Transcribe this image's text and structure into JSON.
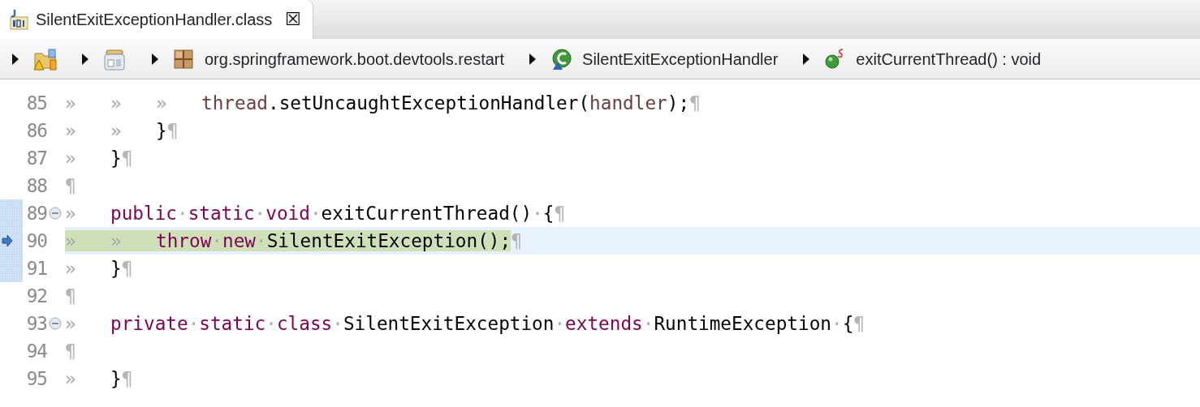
{
  "tab": {
    "title": "SilentExitExceptionHandler.class",
    "selected": true,
    "close": "☒"
  },
  "breadcrumb": [
    {
      "kind": "project"
    },
    {
      "kind": "jar"
    },
    {
      "kind": "package",
      "text": "org.springframework.boot.devtools.restart"
    },
    {
      "kind": "class",
      "text": "SilentExitExceptionHandler"
    },
    {
      "kind": "method",
      "text": "exitCurrentThread() : void"
    }
  ],
  "lines": [
    {
      "number": "85",
      "foldable": false,
      "marked": false,
      "current": false,
      "highlighted": false,
      "tokens": [
        {
          "kind": "tab",
          "text": "»"
        },
        {
          "kind": "tab",
          "text": "»"
        },
        {
          "kind": "tab",
          "text": "»"
        },
        {
          "kind": "var",
          "text": "thread"
        },
        {
          "kind": "plain",
          "text": ".setUncaughtExceptionHandler("
        },
        {
          "kind": "var",
          "text": "handler"
        },
        {
          "kind": "plain",
          "text": ");"
        }
      ],
      "eol": "¶"
    },
    {
      "number": "86",
      "foldable": false,
      "marked": false,
      "current": false,
      "highlighted": false,
      "tokens": [
        {
          "kind": "tab",
          "text": "»"
        },
        {
          "kind": "tab",
          "text": "»"
        },
        {
          "kind": "plain",
          "text": "}"
        }
      ],
      "eol": "¶"
    },
    {
      "number": "87",
      "foldable": false,
      "marked": false,
      "current": false,
      "highlighted": false,
      "tokens": [
        {
          "kind": "tab",
          "text": "»"
        },
        {
          "kind": "plain",
          "text": "}"
        }
      ],
      "eol": "¶"
    },
    {
      "number": "88",
      "foldable": false,
      "marked": false,
      "current": false,
      "highlighted": false,
      "eol": "¶"
    },
    {
      "number": "89",
      "foldable": true,
      "marked": true,
      "current": false,
      "highlighted": false,
      "tokens": [
        {
          "kind": "tab",
          "text": "»"
        },
        {
          "kind": "kw",
          "text": "public"
        },
        {
          "kind": "ws",
          "text": "·"
        },
        {
          "kind": "kw",
          "text": "static"
        },
        {
          "kind": "ws",
          "text": "·"
        },
        {
          "kind": "kw",
          "text": "void"
        },
        {
          "kind": "ws",
          "text": "·"
        },
        {
          "kind": "plain",
          "text": "exitCurrentThread()"
        },
        {
          "kind": "ws",
          "text": "·"
        },
        {
          "kind": "plain",
          "text": "{"
        }
      ],
      "eol": "¶"
    },
    {
      "number": "90",
      "foldable": false,
      "marked": true,
      "current": true,
      "highlighted": true,
      "tokens": [
        {
          "kind": "tab",
          "text": "»"
        },
        {
          "kind": "tab",
          "text": "»"
        },
        {
          "kind": "kw",
          "text": "throw"
        },
        {
          "kind": "ws",
          "text": "·"
        },
        {
          "kind": "kw",
          "text": "new"
        },
        {
          "kind": "ws",
          "text": "·"
        },
        {
          "kind": "plain",
          "text": "SilentExitException();"
        }
      ],
      "eol": "¶"
    },
    {
      "number": "91",
      "foldable": false,
      "marked": true,
      "current": false,
      "highlighted": false,
      "tokens": [
        {
          "kind": "tab",
          "text": "»"
        },
        {
          "kind": "plain",
          "text": "}"
        }
      ],
      "eol": "¶"
    },
    {
      "number": "92",
      "foldable": false,
      "marked": false,
      "current": false,
      "highlighted": false,
      "eol": "¶"
    },
    {
      "number": "93",
      "foldable": true,
      "marked": false,
      "current": false,
      "highlighted": false,
      "tokens": [
        {
          "kind": "tab",
          "text": "»"
        },
        {
          "kind": "kw",
          "text": "private"
        },
        {
          "kind": "ws",
          "text": "·"
        },
        {
          "kind": "kw",
          "text": "static"
        },
        {
          "kind": "ws",
          "text": "·"
        },
        {
          "kind": "kw",
          "text": "class"
        },
        {
          "kind": "ws",
          "text": "·"
        },
        {
          "kind": "plain",
          "text": "SilentExitException"
        },
        {
          "kind": "ws",
          "text": "·"
        },
        {
          "kind": "kw",
          "text": "extends"
        },
        {
          "kind": "ws",
          "text": "·"
        },
        {
          "kind": "plain",
          "text": "RuntimeException"
        },
        {
          "kind": "ws",
          "text": "·"
        },
        {
          "kind": "plain",
          "text": "{"
        }
      ],
      "eol": "¶"
    },
    {
      "number": "94",
      "foldable": false,
      "marked": false,
      "current": false,
      "highlighted": false,
      "eol": "¶"
    },
    {
      "number": "95",
      "foldable": false,
      "marked": false,
      "current": false,
      "highlighted": false,
      "tokens": [
        {
          "kind": "tab",
          "text": "»"
        },
        {
          "kind": "plain",
          "text": "}"
        }
      ],
      "eol": "¶"
    }
  ]
}
